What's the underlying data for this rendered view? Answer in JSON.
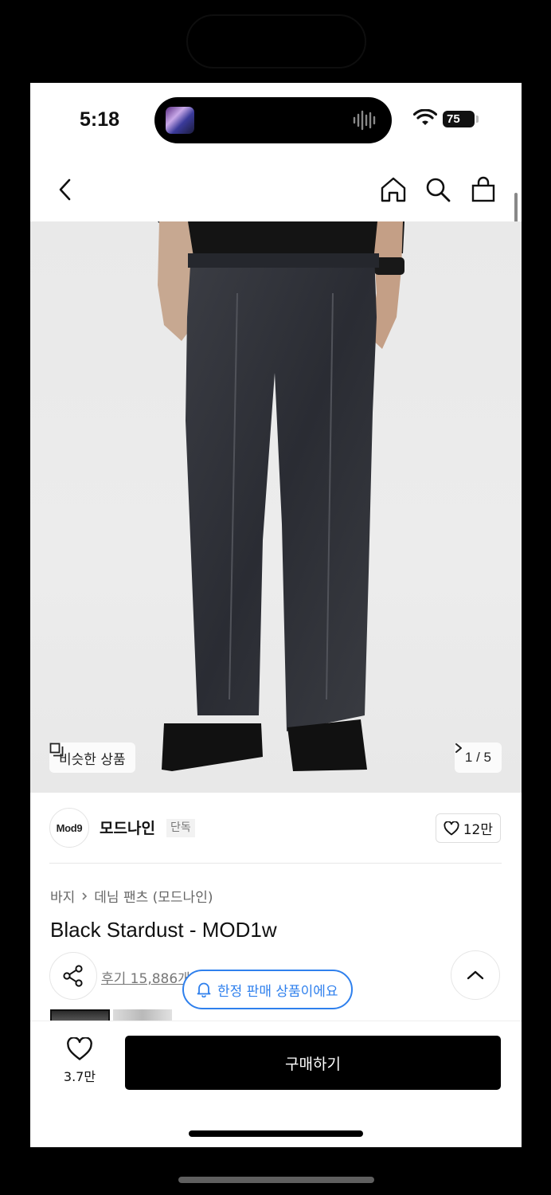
{
  "status_bar": {
    "time": "5:18",
    "battery": "75"
  },
  "nav": {
    "back_icon": "chevron-left-icon",
    "home_icon": "home-icon",
    "search_icon": "search-icon",
    "cart_icon": "shopping-bag-icon"
  },
  "image": {
    "similar_label": "비슷한 상품",
    "pager": "1 / 5"
  },
  "brand": {
    "logo_text": "Mod9",
    "name": "모드나인",
    "tag": "단독",
    "likes": "12만"
  },
  "product": {
    "breadcrumb": [
      "바지",
      "데님 팬츠 (모드나인)"
    ],
    "title": "Black Stardust - MOD1w",
    "reviews": "후기 15,886개",
    "limited_notice": "한정 판매 상품이에요"
  },
  "bottom_bar": {
    "wish_count": "3.7만",
    "buy_label": "구매하기"
  },
  "colors": {
    "accent_blue": "#2f80ed",
    "buy_button": "#000000"
  }
}
